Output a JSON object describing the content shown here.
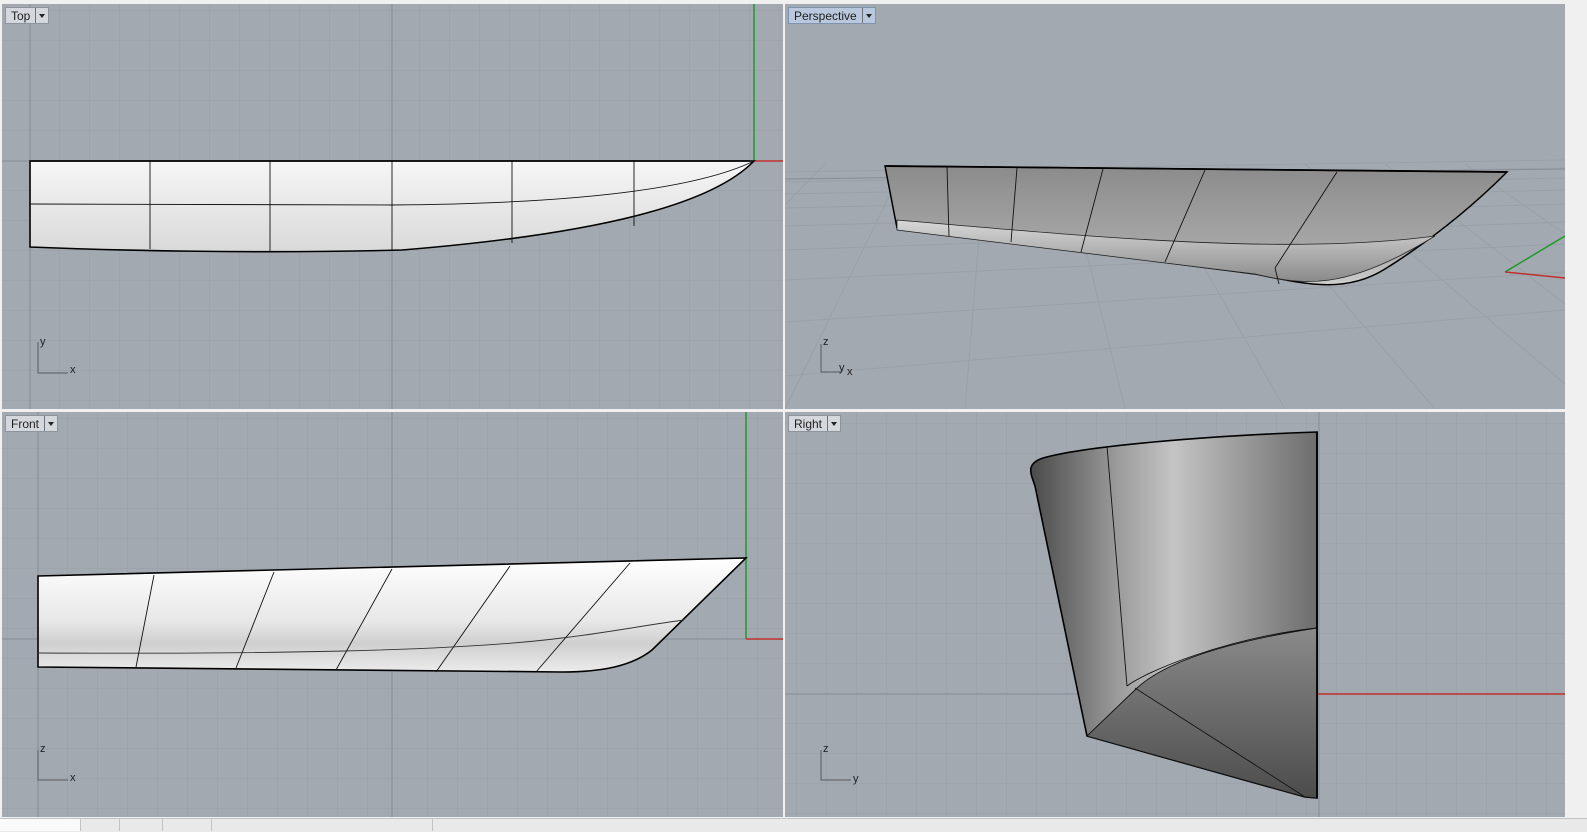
{
  "viewports": {
    "top": {
      "label": "Top",
      "axes": {
        "h": "x",
        "v": "y"
      }
    },
    "perspective": {
      "label": "Perspective",
      "axes": {
        "h": "y",
        "h2": "x",
        "v": "z"
      }
    },
    "front": {
      "label": "Front",
      "axes": {
        "h": "x",
        "v": "z"
      }
    },
    "right": {
      "label": "Right",
      "axes": {
        "h": "y",
        "v": "z"
      }
    }
  },
  "colors": {
    "viewport_bg": "#a3a9b1",
    "grid_minor": "#98a0a8",
    "grid_major": "#858d96",
    "axis_x": "#c0302c",
    "axis_y": "#1e9a2c",
    "active_tab": "#b9c8dc"
  }
}
